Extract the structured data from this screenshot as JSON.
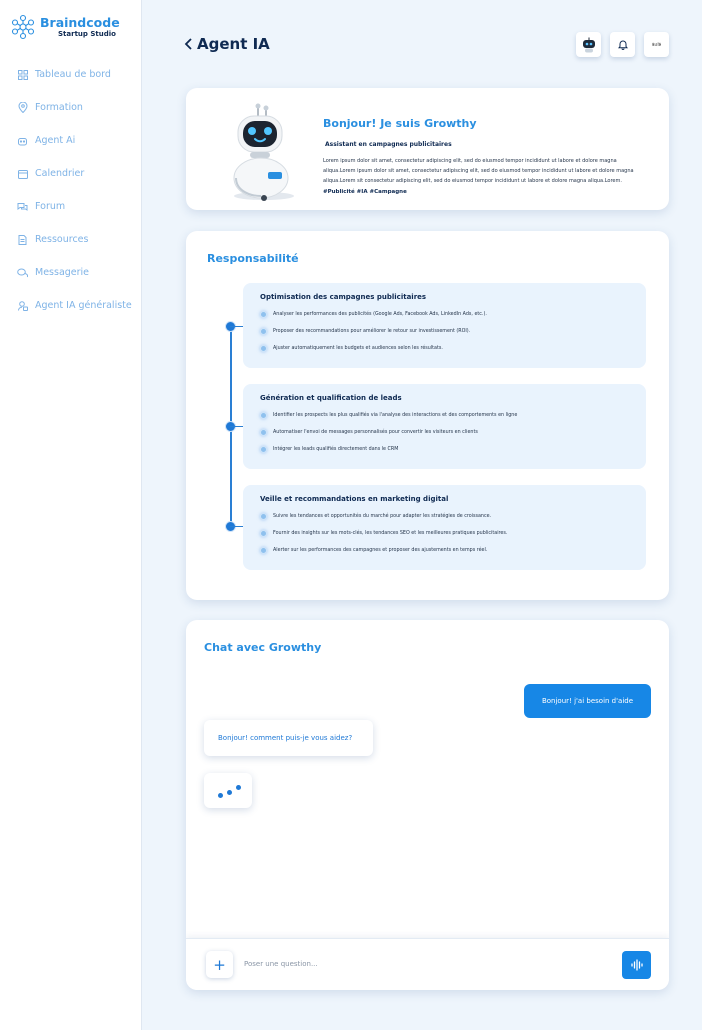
{
  "brand": {
    "name": "Braindcode",
    "tagline": "Startup Studio",
    "accent": "#2a8fe0"
  },
  "sidebar": {
    "items": [
      {
        "label": "Tableau de bord",
        "icon": "grid-icon"
      },
      {
        "label": "Formation",
        "icon": "location-pin-icon"
      },
      {
        "label": "Agent Ai",
        "icon": "robot-icon"
      },
      {
        "label": "Calendrier",
        "icon": "calendar-icon"
      },
      {
        "label": "Forum",
        "icon": "chat-bubbles-icon"
      },
      {
        "label": "Ressources",
        "icon": "document-icon"
      },
      {
        "label": "Messagerie",
        "icon": "messages-icon"
      },
      {
        "label": "Agent IA généraliste",
        "icon": "user-agent-icon"
      }
    ]
  },
  "header": {
    "title": "Agent IA",
    "back_icon": "chevron-left-icon",
    "avatar_text": "𝔰𝔲𝔦𝔰"
  },
  "intro": {
    "greeting": "Bonjour!  Je suis Growthy",
    "subtitle": "Assistant en campagnes publicitaires",
    "description": "Lorem ipsum dolor sit amet, consectetur adipiscing elit, sed do eiusmod tempor incididunt ut labore et dolore magna aliqua.Lorem ipsum dolor sit amet, consectetur adipiscing elit, sed do eiusmod tempor incididunt ut labore et dolore magna aliqua.Lorem sit consectetur adipiscing elit, sed do eiusmod tempor incididunt ut labore et dolore magna aliqua.Lorem.",
    "tags": "#Publicité  #IA #Campagne"
  },
  "responsabilite": {
    "title": "Responsabilité",
    "sections": [
      {
        "title": "Optimisation des campagnes publicitaires",
        "items": [
          "Analyser les performances des publicités (Google Ads, Facebook Ads, LinkedIn Ads, etc.).",
          "Proposer des recommandations pour améliorer le retour sur investissement (ROI).",
          "Ajuster automatiquement les budgets et audiences selon les résultats."
        ]
      },
      {
        "title": "Génération et qualification de leads",
        "items": [
          "Identifier les prospects les plus qualifiés via l'analyse des interactions et des comportements en ligne",
          "Automatiser l'envoi de messages personnalisés pour convertir les visiteurs en clients",
          "Intégrer les leads qualifiés directement dans le CRM"
        ]
      },
      {
        "title": "Veille et recommandations en marketing digital",
        "items": [
          "Suivre les tendances et opportunités du marché pour adapter les stratégies de croissance.",
          "Fournir des insights sur les mots-clés, les tendances SEO et les meilleures pratiques publicitaires.",
          "Alerter sur les performances des campagnes et proposer des ajustements en temps réel."
        ]
      }
    ]
  },
  "chat": {
    "title": "Chat avec Growthy",
    "messages": [
      {
        "from": "user",
        "text": "Bonjour! j'ai besoin d'aide"
      },
      {
        "from": "bot",
        "text": "Bonjour! comment puis-je vous aidez?"
      }
    ],
    "input_placeholder": "Poser une question...",
    "plus_label": "+"
  }
}
